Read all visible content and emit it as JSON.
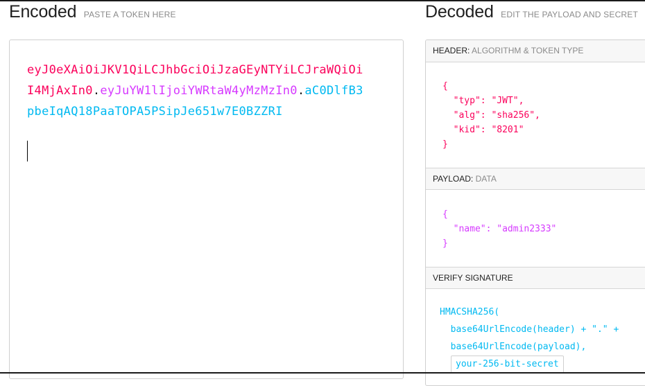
{
  "encoded": {
    "title": "Encoded",
    "subtitle": "PASTE A TOKEN HERE",
    "token_header": "eyJ0eXAiOiJKV1QiLCJhbGciOiJzaGEyNTYiLCJraWQiOiI4MjAxIn0",
    "token_payload": "eyJuYW1lIjoiYWRtaW4yMzMzIn0",
    "token_signature": "aC0DlfB3pbeIqAQ18PaaTOPA5PSipJe651w7E0BZZRI",
    "separator": "."
  },
  "decoded": {
    "title": "Decoded",
    "subtitle": "EDIT THE PAYLOAD AND SECRET",
    "header_section": {
      "label": "HEADER:",
      "desc": "ALGORITHM & TOKEN TYPE",
      "json": "{\n  \"typ\": \"JWT\",\n  \"alg\": \"sha256\",\n  \"kid\": \"8201\"\n}"
    },
    "payload_section": {
      "label": "PAYLOAD:",
      "desc": "DATA",
      "json": "{\n  \"name\": \"admin2333\"\n}"
    },
    "verify_section": {
      "label": "VERIFY SIGNATURE",
      "line1": "HMACSHA256(",
      "line2": "  base64UrlEncode(header) + \".\" +",
      "line3": "  base64UrlEncode(payload),",
      "secret": "your-256-bit-secret"
    }
  },
  "colors": {
    "header": "#fb015b",
    "payload": "#d63aff",
    "signature": "#00b9f1"
  }
}
